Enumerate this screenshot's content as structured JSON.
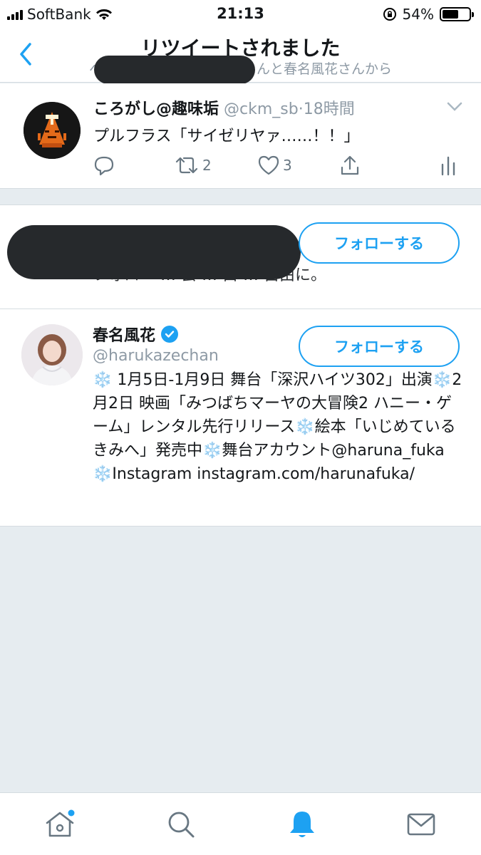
{
  "status_bar": {
    "carrier": "SoftBank",
    "time": "21:13",
    "battery": "54%"
  },
  "header": {
    "title": "リツイートされました",
    "subtitle_prefix": "へ",
    "subtitle_suffix": "んと春名風花さんから"
  },
  "tweet": {
    "author_name": "ころがし@趣味垢",
    "author_handle": "@ckm_sb",
    "separator": "·",
    "time_ago": "18時間",
    "text": "プルフラス「サイゼリヤァ……！！」",
    "retweet_count": "2",
    "like_count": "3",
    "icons": [
      "reply-icon",
      "retweet-icon",
      "like-icon",
      "share-icon",
      "analytics-icon"
    ]
  },
  "users": [
    {
      "visible_bio_fragment": "フォロー … 会 … 白 … 自由に。",
      "follow_label": "フォローする"
    },
    {
      "name": "春名風花",
      "handle": "@harukazechan",
      "verified": true,
      "follow_label": "フォローする",
      "bio": "❄️ 1月5日-1月9日 舞台「深沢ハイツ302」出演❄️2月2日 映画「みつばちマーヤの大冒険2 ハニー・ゲーム」レンタル先行リリース❄️絵本「いじめているきみへ」発売中❄️舞台アカウント@haruna_fuka ❄️Instagram instagram.com/harunafuka/"
    }
  ],
  "tab_bar": {
    "items": [
      "home-icon",
      "search-icon",
      "notifications-icon",
      "messages-icon"
    ],
    "active": "notifications-icon"
  },
  "colors": {
    "accent": "#1da1f2",
    "muted_text": "#8e9aa5",
    "background": "#e6ecf0"
  }
}
